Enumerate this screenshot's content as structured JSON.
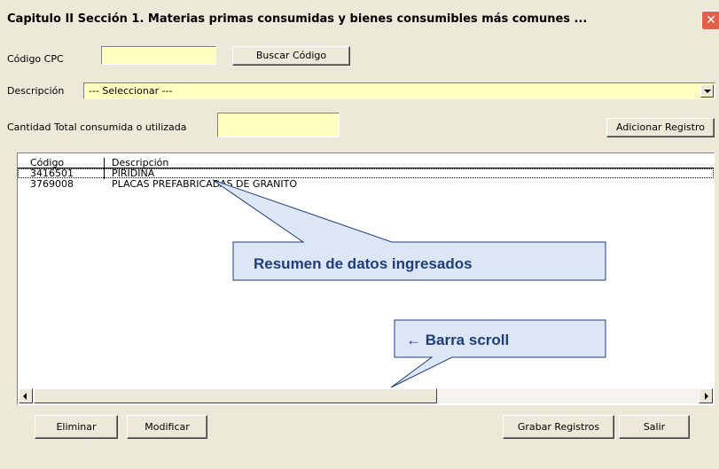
{
  "window": {
    "title": "Capitulo II Sección 1. Materias primas consumidas y bienes consumibles más comunes ...",
    "close_glyph": "✕"
  },
  "form": {
    "codigo_label": "Código CPC",
    "codigo_value": "",
    "buscar_button": "Buscar Código",
    "descripcion_label": "Descripción",
    "descripcion_selected": "--- Seleccionar ---",
    "cantidad_label": "Cantidad Total consumida o utilizada",
    "cantidad_value": "",
    "adicionar_button": "Adicionar Registro"
  },
  "list": {
    "columns": [
      "Código",
      "Descripción"
    ],
    "rows": [
      {
        "codigo": "3416501",
        "descripcion": "PIRIDINA"
      },
      {
        "codigo": "3769008",
        "descripcion": "PLACAS PREFABRICADAS DE GRANITO"
      }
    ]
  },
  "callouts": {
    "resumen": "Resumen de datos ingresados",
    "scroll": "← Barra scroll"
  },
  "footer": {
    "eliminar": "Eliminar",
    "modificar": "Modificar",
    "grabar": "Grabar Registros",
    "salir": "Salir"
  },
  "colors": {
    "dialog_bg": "#ece9d8",
    "input_bg": "#ffffc0",
    "callout_fill": "#dde6f4",
    "callout_text": "#1f3d7a"
  },
  "icons": [
    "close-icon",
    "dropdown-arrow-icon",
    "scroll-left-icon",
    "scroll-right-icon"
  ]
}
